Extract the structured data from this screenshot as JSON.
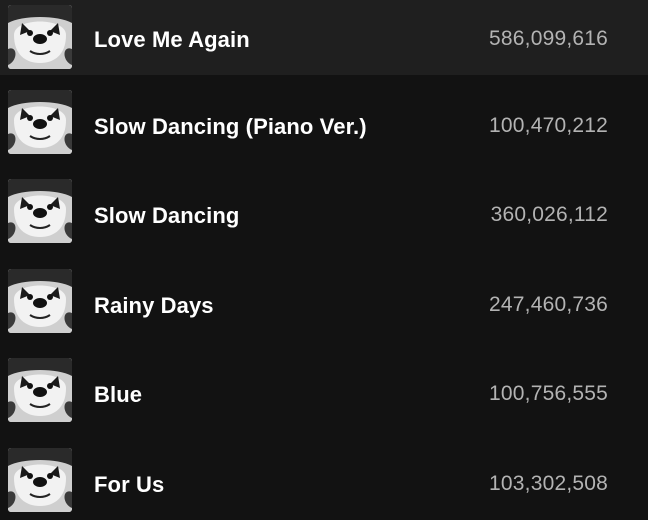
{
  "tracks": [
    {
      "title": "Love Me Again",
      "plays": "586,099,616"
    },
    {
      "title": "Slow Dancing (Piano Ver.)",
      "plays": "100,470,212"
    },
    {
      "title": "Slow Dancing",
      "plays": "360,026,112"
    },
    {
      "title": "Rainy Days",
      "plays": "247,460,736"
    },
    {
      "title": "Blue",
      "plays": "100,756,555"
    },
    {
      "title": "For Us",
      "plays": "103,302,508"
    }
  ],
  "colors": {
    "background": "#121212",
    "row_highlight": "#1f1f1f",
    "title_text": "#ffffff",
    "plays_text": "#b3b3b3"
  },
  "icons": {
    "cover_art": "album-cover-dog-icon"
  }
}
